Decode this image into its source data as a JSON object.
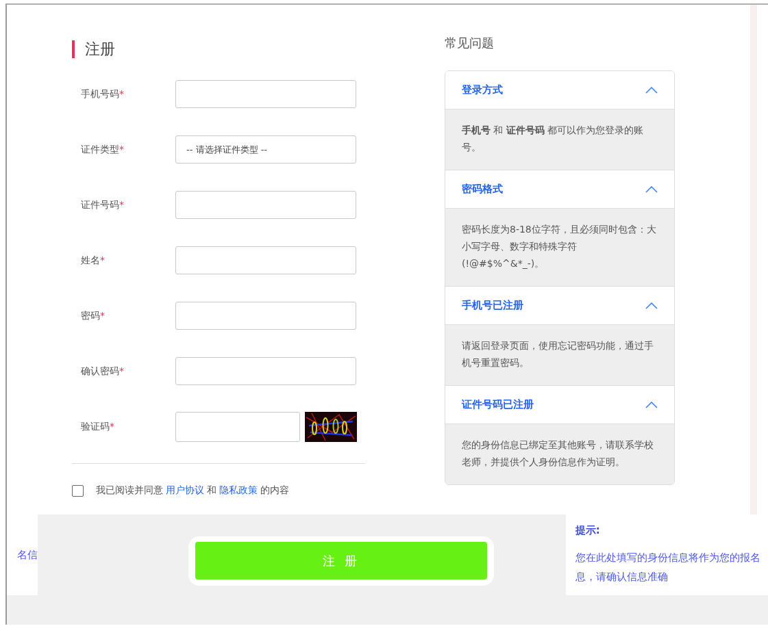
{
  "form": {
    "title": "注册",
    "fields": [
      {
        "label": "手机号码",
        "required_mark": "*",
        "kind": "text"
      },
      {
        "label": "证件类型",
        "required_mark": "*",
        "kind": "select",
        "value": "-- 请选择证件类型 --"
      },
      {
        "label": "证件号码",
        "required_mark": "*",
        "kind": "text"
      },
      {
        "label": "姓名",
        "required_mark": "*",
        "kind": "text"
      },
      {
        "label": "密码",
        "required_mark": "*",
        "kind": "password"
      },
      {
        "label": "确认密码",
        "required_mark": "*",
        "kind": "password"
      },
      {
        "label": "验证码",
        "required_mark": "*",
        "kind": "captcha"
      }
    ],
    "agreement": {
      "checked": false,
      "parts": [
        {
          "kind": "text",
          "text": "我已阅读并同意"
        },
        {
          "kind": "link",
          "text": "用户协议"
        },
        {
          "kind": "text",
          "text": "和"
        },
        {
          "kind": "link",
          "text": "隐私政策"
        },
        {
          "kind": "text",
          "text": "的内容"
        }
      ]
    }
  },
  "faq": {
    "title": "常见问题",
    "items": [
      {
        "question": "登录方式",
        "expanded": true,
        "answer": "**手机号** 和 **证件号码** 都可以作为您登录的账号。"
      },
      {
        "question": "密码格式",
        "expanded": true,
        "answer": "密码长度为8-18位字符，且必须同时包含：大小写字母、数字和特殊字符(!@#$%^&*_-)。"
      },
      {
        "question": "手机号已注册",
        "expanded": true,
        "answer": "请返回登录页面，使用忘记密码功能，通过手机号重置密码。"
      },
      {
        "question": "证件号码已注册",
        "expanded": true,
        "answer": "您的身份信息已绑定至其他账号，请联系学校老师，并提供个人身份信息作为证明。"
      }
    ]
  },
  "footer": {
    "fragment": "名信",
    "submit": "注 册",
    "tip": {
      "title": "提示:",
      "lines": [
        "您在此处填写的身份信息将作为您的报名",
        "息，请确认信息准确"
      ]
    }
  }
}
